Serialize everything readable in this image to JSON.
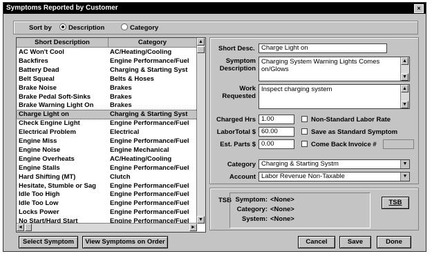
{
  "window": {
    "title": "Symptoms Reported by Customer",
    "close": "×"
  },
  "sortby": {
    "label": "Sort by",
    "option1": "Description",
    "option2": "Category",
    "selected": "Description"
  },
  "list": {
    "col1": "Short Description",
    "col2": "Category",
    "rows": [
      {
        "d": "AC Won't Cool",
        "c": "AC/Heating/Cooling"
      },
      {
        "d": "Backfires",
        "c": "Engine Performance/Fuel"
      },
      {
        "d": "Battery Dead",
        "c": "Charging & Starting Syst"
      },
      {
        "d": "Belt Squeal",
        "c": "Belts & Hoses"
      },
      {
        "d": "Brake Noise",
        "c": "Brakes"
      },
      {
        "d": "Brake Pedal Soft-Sinks",
        "c": "Brakes"
      },
      {
        "d": "Brake Warning Light On",
        "c": "Brakes"
      },
      {
        "d": "Charge Light on",
        "c": "Charging & Starting Syst"
      },
      {
        "d": "Check Engine Light",
        "c": "Engine Performance/Fuel"
      },
      {
        "d": "Electrical Problem",
        "c": "Electrical"
      },
      {
        "d": "Engine Miss",
        "c": "Engine Performance/Fuel"
      },
      {
        "d": "Engine Noise",
        "c": "Engine Mechanical"
      },
      {
        "d": "Engine Overheats",
        "c": "AC/Heating/Cooling"
      },
      {
        "d": "Engine Stalls",
        "c": "Engine Performance/Fuel"
      },
      {
        "d": "Hard Shifting (MT)",
        "c": "Clutch"
      },
      {
        "d": "Hesitate, Stumble or Sag",
        "c": "Engine Performance/Fuel"
      },
      {
        "d": "Idle Too High",
        "c": "Engine Performance/Fuel"
      },
      {
        "d": "Idle Too Low",
        "c": "Engine Performance/Fuel"
      },
      {
        "d": "Locks Power",
        "c": "Engine Performance/Fuel"
      },
      {
        "d": "No Start/Hard Start",
        "c": "Engine Performance/Fuel"
      }
    ],
    "selected_index": 7
  },
  "form": {
    "short_desc_label": "Short Desc.",
    "short_desc": "Charge Light on",
    "symptom_desc_label1": "Symptom",
    "symptom_desc_label2": "Description",
    "symptom_desc": "Charging System Warning Lights Comes on/Glows",
    "work_req_label1": "Work",
    "work_req_label2": "Requested",
    "work_req": "Inspect charging system",
    "charged_hrs_label": "Charged Hrs",
    "charged_hrs": "1.00",
    "labor_total_label": "LaborTotal $",
    "labor_total": "60.00",
    "est_parts_label": "Est. Parts $",
    "est_parts": "0.00",
    "nonstd_label": "Non-Standard Labor Rate",
    "save_std_label": "Save as Standard Symptom",
    "comeback_label": "Come Back",
    "invoice_label": "Invoice #",
    "category_label": "Category",
    "category": "Charging & Starting Systm",
    "account_label": "Account",
    "account": "Labor Revenue Non-Taxable"
  },
  "tsb": {
    "label": "TSB",
    "symptom_label": "Symptom:",
    "symptom": "<None>",
    "category_label": "Category:",
    "category": "<None>",
    "system_label": "System:",
    "system": "<None>",
    "button": "TSB"
  },
  "buttons": {
    "select_symptom": "Select Symptom",
    "view_symptoms": "View Symptoms on Order",
    "cancel": "Cancel",
    "save": "Save",
    "done": "Done"
  }
}
